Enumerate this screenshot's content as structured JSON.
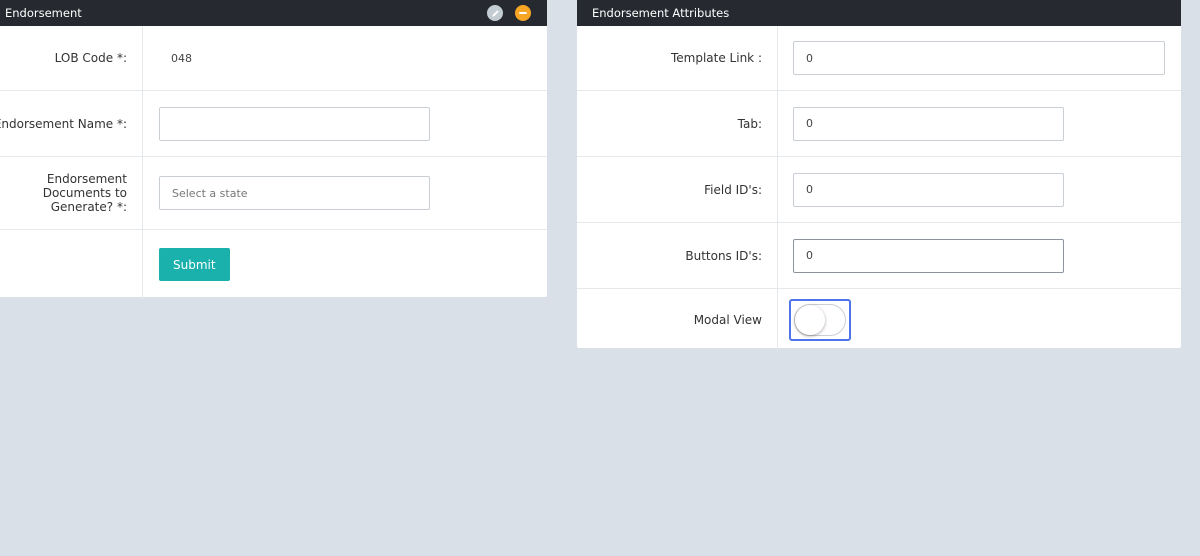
{
  "left_panel": {
    "title": "Endorsement",
    "rows": [
      {
        "label": "LOB Code *:",
        "value": "048"
      },
      {
        "label": "Endorsement Name *:",
        "value": ""
      },
      {
        "label_line1": "Endorsement Documents to",
        "label_line2": "Generate? *:",
        "placeholder": "Select a state"
      }
    ],
    "submit_label": "Submit"
  },
  "right_panel": {
    "title": "Endorsement Attributes",
    "rows": [
      {
        "label": "Template Link :",
        "value": "0"
      },
      {
        "label": "Tab:",
        "value": "0"
      },
      {
        "label": "Field ID's:",
        "value": "0"
      },
      {
        "label": "Buttons ID's:",
        "value": "0"
      },
      {
        "label": "Modal View",
        "toggle_on": false
      }
    ]
  },
  "colors": {
    "header_bg": "#262a30",
    "page_bg": "#d9e0e7",
    "submit_bg": "#1ab0ac",
    "collapse_icon": "#f6a623",
    "focus_outline": "#4f73ea"
  },
  "icons": {
    "edit": "pencil-icon",
    "collapse": "minus-circle-icon"
  }
}
